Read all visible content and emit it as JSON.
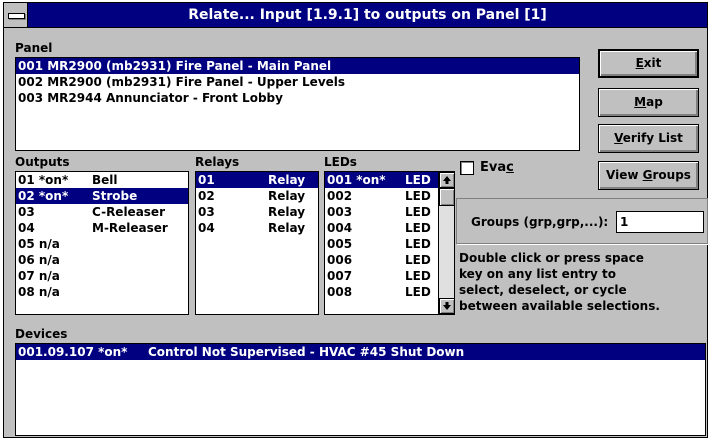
{
  "window": {
    "title": "Relate... Input [1.9.1] to outputs on Panel [1]"
  },
  "panel": {
    "label": "Panel",
    "items": [
      "001 MR2900 (mb2931) Fire Panel - Main Panel",
      "002 MR2900 (mb2931) Fire Panel - Upper Levels",
      "003 MR2944 Annunciator - Front Lobby"
    ],
    "selected_index": 0
  },
  "buttons": {
    "exit": {
      "pre": "",
      "ul": "E",
      "post": "xit"
    },
    "map": {
      "pre": "",
      "ul": "M",
      "post": "ap"
    },
    "verify": {
      "pre": "",
      "ul": "V",
      "post": "erify List"
    },
    "groups": {
      "pre": "View ",
      "ul": "G",
      "post": "roups"
    }
  },
  "outputs": {
    "label": "Outputs",
    "items": [
      {
        "num": "01 *on*",
        "name": "Bell"
      },
      {
        "num": "02 *on*",
        "name": "Strobe"
      },
      {
        "num": "03",
        "name": "C-Releaser"
      },
      {
        "num": "04",
        "name": "M-Releaser"
      },
      {
        "num": "05 n/a",
        "name": ""
      },
      {
        "num": "06 n/a",
        "name": ""
      },
      {
        "num": "07 n/a",
        "name": ""
      },
      {
        "num": "08 n/a",
        "name": ""
      }
    ],
    "selected_index": 1
  },
  "relays": {
    "label": "Relays",
    "items": [
      {
        "num": "01",
        "type": "Relay"
      },
      {
        "num": "02",
        "type": "Relay"
      },
      {
        "num": "03",
        "type": "Relay"
      },
      {
        "num": "04",
        "type": "Relay"
      }
    ],
    "selected_index": 0
  },
  "leds": {
    "label": "LEDs",
    "items": [
      {
        "num": "001 *on*",
        "type": "LED"
      },
      {
        "num": "002",
        "type": "LED"
      },
      {
        "num": "003",
        "type": "LED"
      },
      {
        "num": "004",
        "type": "LED"
      },
      {
        "num": "005",
        "type": "LED"
      },
      {
        "num": "006",
        "type": "LED"
      },
      {
        "num": "007",
        "type": "LED"
      },
      {
        "num": "008",
        "type": "LED"
      }
    ],
    "selected_index": 0,
    "scroll_up_icon": "arrow-up-icon",
    "scroll_down_icon": "arrow-down-icon"
  },
  "evac": {
    "pre": "Eva",
    "ul": "c",
    "checked": false
  },
  "groups_field": {
    "label": "Groups (grp,grp,...):",
    "value": "1"
  },
  "help_text": [
    "Double click or press space",
    "key on any list entry to",
    "select, deselect, or cycle",
    "between available selections."
  ],
  "devices": {
    "label": "Devices",
    "items": [
      {
        "addr": "001.09.107 *on*",
        "desc": "Control Not Supervised - HVAC #45 Shut Down"
      }
    ],
    "selected_index": 0
  },
  "colors": {
    "selection": "#000080",
    "face": "#c0c0c0",
    "title": "#000080"
  }
}
